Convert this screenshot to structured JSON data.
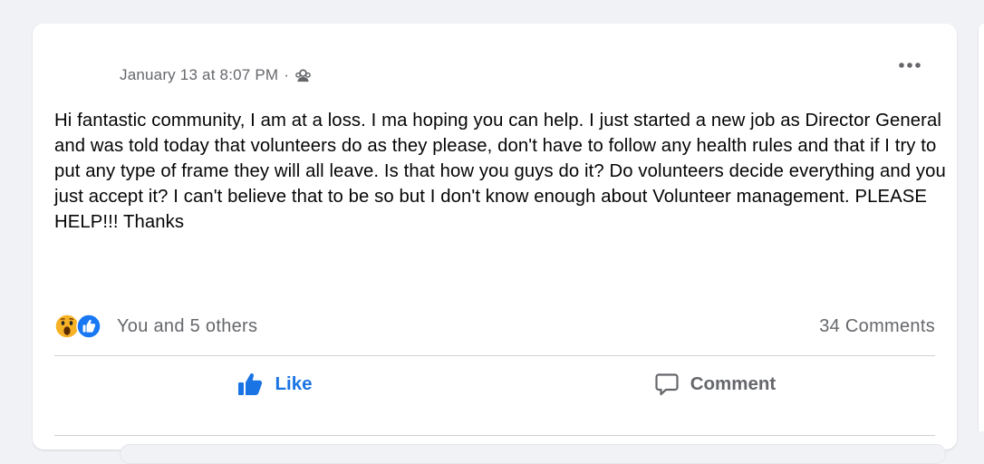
{
  "post": {
    "timestamp": "January 13 at 8:07 PM",
    "separator": "·",
    "audience_icon": "group-icon",
    "more_icon": "more-horizontal-icon",
    "text": "Hi fantastic community, I am at a loss. I ma hoping you can help. I just started a new job as Director General and was told today that volunteers do as they please, don't have to follow any health rules and that if I try to put any type of frame they will all leave. Is that how you guys do it? Do volunteers decide everything and you just accept it? I can't believe that to be so but I don't know enough about Volunteer management. PLEASE HELP!!! Thanks"
  },
  "stats": {
    "reaction_icons": [
      "wow-reaction-icon",
      "like-reaction-icon"
    ],
    "reactions_text": "You and 5 others",
    "comments_text": "34 Comments"
  },
  "actions": {
    "like_label": "Like",
    "comment_label": "Comment"
  },
  "colors": {
    "accent": "#1b74e4",
    "secondary_text": "#65676b",
    "primary_text": "#050505",
    "background": "#f0f2f5"
  }
}
